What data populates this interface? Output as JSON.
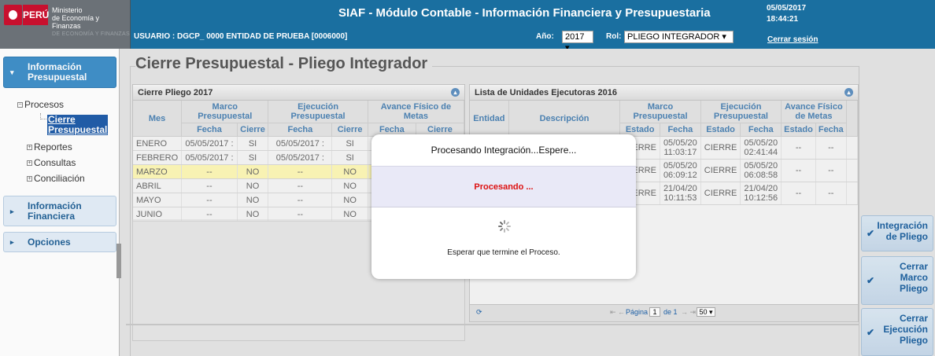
{
  "header": {
    "brand": "PERÚ",
    "ministry_line1": "Ministerio",
    "ministry_line2": "de Economía y Finanzas",
    "ministry_sub": "DE ECONOMÍA Y FINANZAS",
    "app_title": "SIAF - Módulo Contable - Información Financiera y Presupuestaria",
    "date": "05/05/2017",
    "time": "18:44:21",
    "user_line": "USUARIO : DGCP_ 0000   ENTIDAD DE PRUEBA [0006000]",
    "year_label": "Año:",
    "year_value": "2017 ▾",
    "rol_label": "Rol:",
    "rol_value": "PLIEGO INTEGRADOR ▾",
    "logout": "Cerrar sesión"
  },
  "sidebar": {
    "info_presupuestal": "Información Presupuestal",
    "procesos": "Procesos",
    "cierre_presupuestal_1": "Cierre",
    "cierre_presupuestal_2": "Presupuestal",
    "reportes": "Reportes",
    "consultas": "Consultas",
    "conciliacion": "Conciliación",
    "info_financiera": "Información Financiera",
    "opciones": "Opciones"
  },
  "main": {
    "page_title": "Cierre Presupuestal - Pliego Integrador"
  },
  "panel1": {
    "title": "Cierre Pliego 2017",
    "col_mes": "Mes",
    "grp_marco": "Marco Presupuestal",
    "grp_ejec": "Ejecución Presupuestal",
    "grp_avance": "Avance Físico de Metas",
    "sub_fecha": "Fecha",
    "sub_cierre": "Cierre",
    "rows": [
      {
        "mes": "ENERO",
        "f1": "05/05/2017 :",
        "c1": "SI",
        "f2": "05/05/2017 :",
        "c2": "SI",
        "f3": "",
        "c3": ""
      },
      {
        "mes": "FEBRERO",
        "f1": "05/05/2017 :",
        "c1": "SI",
        "f2": "05/05/2017 :",
        "c2": "SI",
        "f3": "",
        "c3": ""
      },
      {
        "mes": "MARZO",
        "f1": "--",
        "c1": "NO",
        "f2": "--",
        "c2": "NO",
        "f3": "",
        "c3": ""
      },
      {
        "mes": "ABRIL",
        "f1": "--",
        "c1": "NO",
        "f2": "--",
        "c2": "NO",
        "f3": "",
        "c3": ""
      },
      {
        "mes": "MAYO",
        "f1": "--",
        "c1": "NO",
        "f2": "--",
        "c2": "NO",
        "f3": "",
        "c3": ""
      },
      {
        "mes": "JUNIO",
        "f1": "--",
        "c1": "NO",
        "f2": "--",
        "c2": "NO",
        "f3": "",
        "c3": ""
      }
    ]
  },
  "panel2": {
    "title": "Lista de Unidades Ejecutoras 2016",
    "col_entidad": "Entidad",
    "col_desc": "Descripción",
    "grp_marco": "Marco Presupuestal",
    "grp_ejec": "Ejecución Presupuestal",
    "grp_avance": "Avance Físico de Metas",
    "sub_estado": "Estado",
    "sub_fecha": "Fecha",
    "rows": [
      {
        "e1": "CIERRE",
        "f1": "05/05/20 11:03:17",
        "e2": "CIERRE",
        "f2": "05/05/20 02:41:44",
        "e3": "--",
        "f3": "--"
      },
      {
        "e1": "CIERRE",
        "f1": "05/05/20 06:09:12",
        "e2": "CIERRE",
        "f2": "05/05/20 06:08:58",
        "e3": "--",
        "f3": "--"
      },
      {
        "e1": "CIERRE",
        "f1": "21/04/20 10:11:53",
        "e2": "CIERRE",
        "f2": "21/04/20 10:12:56",
        "e3": "--",
        "f3": "--"
      }
    ],
    "pager_label": "Página",
    "pager_page": "1",
    "pager_of": "de 1",
    "pager_size": "50 ▾"
  },
  "buttons": {
    "integracion_1": "Integración",
    "integracion_2": "de Pliego",
    "marco_1": "Cerrar",
    "marco_2": "Marco",
    "marco_3": "Pliego",
    "ejec_1": "Cerrar",
    "ejec_2": "Ejecución",
    "ejec_3": "Pliego"
  },
  "modal": {
    "title": "Procesando Integración...Espere...",
    "status": "Procesando ...",
    "wait": "Esperar que termine el Proceso."
  }
}
